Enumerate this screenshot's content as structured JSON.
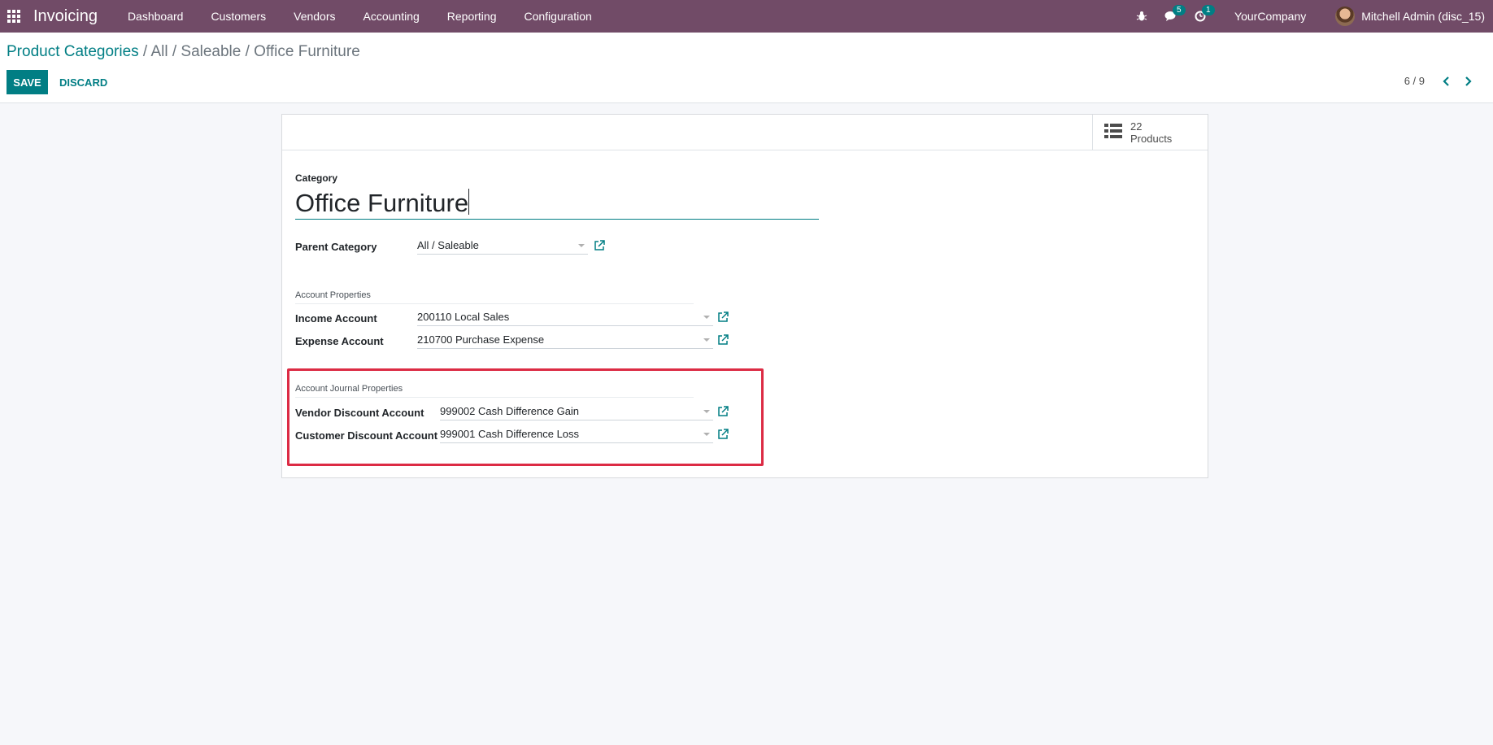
{
  "navbar": {
    "app_name": "Invoicing",
    "menu": [
      "Dashboard",
      "Customers",
      "Vendors",
      "Accounting",
      "Reporting",
      "Configuration"
    ],
    "messages_count": "5",
    "activities_count": "1",
    "company": "YourCompany",
    "user": "Mitchell Admin (disc_15)"
  },
  "control_panel": {
    "breadcrumb_root": "Product Categories",
    "breadcrumb_current": " / All / Saleable / Office Furniture",
    "save_label": "SAVE",
    "discard_label": "DISCARD",
    "pager": "6 / 9"
  },
  "smart_button": {
    "count": "22",
    "label": "Products"
  },
  "form": {
    "category_label": "Category",
    "category_name": "Office Furniture",
    "parent_category_label": "Parent Category",
    "parent_category_value": "All / Saleable",
    "account_properties_title": "Account Properties",
    "income_account_label": "Income Account",
    "income_account_value": "200110 Local Sales",
    "expense_account_label": "Expense Account",
    "expense_account_value": "210700 Purchase Expense",
    "journal_properties_title": "Account Journal Properties",
    "vendor_discount_label": "Vendor Discount Account",
    "vendor_discount_value": "999002 Cash Difference Gain",
    "customer_discount_label": "Customer Discount Account",
    "customer_discount_value": "999001 Cash Difference Loss"
  },
  "colors": {
    "navbar": "#714b67",
    "primary": "#017e84",
    "highlight": "#dc2b44"
  }
}
